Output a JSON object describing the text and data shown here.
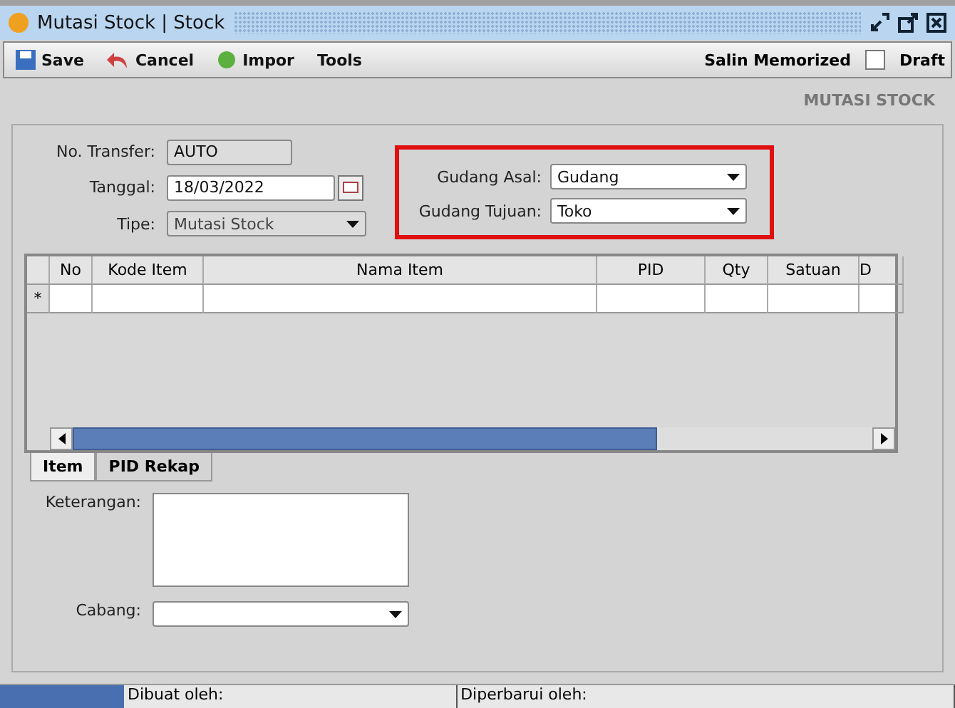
{
  "window": {
    "title": "Mutasi Stock | Stock"
  },
  "toolbar": {
    "buttons": [
      {
        "label": "Save",
        "kind": "save"
      },
      {
        "label": "Cancel",
        "kind": "cancel"
      },
      {
        "label": "Impor",
        "kind": "import"
      },
      {
        "label": "Tools",
        "kind": "menu"
      }
    ],
    "salin": "Salin Memorized",
    "draft": {
      "label": "Draft",
      "checked": false
    }
  },
  "form_title": "MUTASI STOCK",
  "fields": {
    "no_transfer": {
      "label": "No. Transfer:",
      "value": "AUTO"
    },
    "tanggal": {
      "label": "Tanggal:",
      "value": "18/03/2022"
    },
    "tipe": {
      "label": "Tipe:",
      "value": "Mutasi Stock",
      "disabled": true
    }
  },
  "gudang": {
    "highlighted": true,
    "asal": {
      "label": "Gudang Asal:",
      "value": "Gudang"
    },
    "tujuan": {
      "label": "Gudang Tujuan:",
      "value": "Toko"
    }
  },
  "table": {
    "columns": [
      "No",
      "Kode Item",
      "Nama Item",
      "PID",
      "Qty",
      "Satuan",
      "D"
    ],
    "new_row_marker": "*",
    "scrollbar": {
      "level": 0.73
    }
  },
  "tabs": [
    {
      "label": "Item",
      "selected": true
    },
    {
      "label": "PID Rekap",
      "selected": false
    }
  ],
  "keterangan": {
    "label": "Keterangan:"
  },
  "cabang": {
    "label": "Cabang:"
  },
  "status_bar": [
    "Dibuat oleh:",
    "Diperbarui oleh:"
  ]
}
